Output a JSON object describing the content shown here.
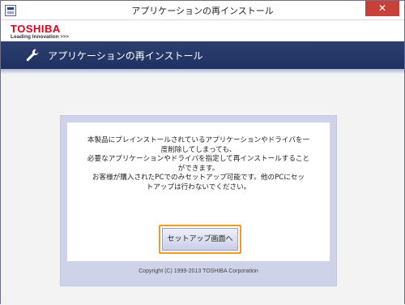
{
  "window": {
    "title": "アプリケーションの再インストール",
    "close_label": "✕"
  },
  "brand": {
    "logo": "TOSHIBA",
    "tagline": "Leading Innovation",
    "tagline_arrows": ">>>",
    "logo_color": "#e0001a"
  },
  "header": {
    "icon": "wrench-icon",
    "title": "アプリケーションの再インストール",
    "band_color": "#2c3f6e"
  },
  "message": {
    "lines": [
      "本製品にプレインストールされているアプリケーションやドライバを一",
      "度削除してしまっても、",
      "必要なアプリケーションやドライバを指定して再インストールすること",
      "ができます。",
      "お客様が購入されたPCでのみセットアップ可能です。他のPCにセッ",
      "トアップは行わないでください。"
    ]
  },
  "actions": {
    "setup_label": "セットアップ画面へ",
    "focus_color": "#f39a21"
  },
  "footer": {
    "copyright": "Copyright (C) 1999-2013 TOSHIBA Corporation"
  }
}
